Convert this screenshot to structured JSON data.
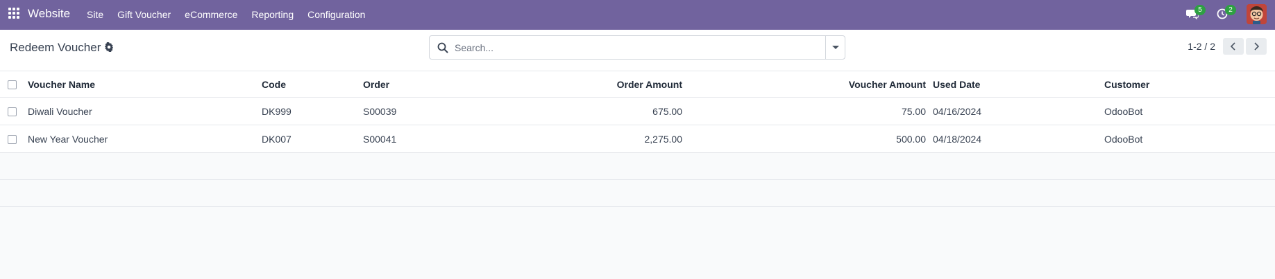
{
  "navbar": {
    "app_name": "Website",
    "menu": [
      "Site",
      "Gift Voucher",
      "eCommerce",
      "Reporting",
      "Configuration"
    ],
    "messages_count": "5",
    "activities_count": "2",
    "accent_color": "#71639e"
  },
  "control_panel": {
    "title": "Redeem Voucher",
    "search_placeholder": "Search...",
    "pager_value": "1-2 / 2"
  },
  "table": {
    "columns": [
      "Voucher Name",
      "Code",
      "Order",
      "Order Amount",
      "Voucher Amount",
      "Used Date",
      "Customer"
    ],
    "rows": [
      {
        "voucher_name": "Diwali Voucher",
        "code": "DK999",
        "order": "S00039",
        "order_amount": "675.00",
        "voucher_amount": "75.00",
        "used_date": "04/16/2024",
        "customer": "OdooBot"
      },
      {
        "voucher_name": "New Year Voucher",
        "code": "DK007",
        "order": "S00041",
        "order_amount": "2,275.00",
        "voucher_amount": "500.00",
        "used_date": "04/18/2024",
        "customer": "OdooBot"
      }
    ]
  }
}
